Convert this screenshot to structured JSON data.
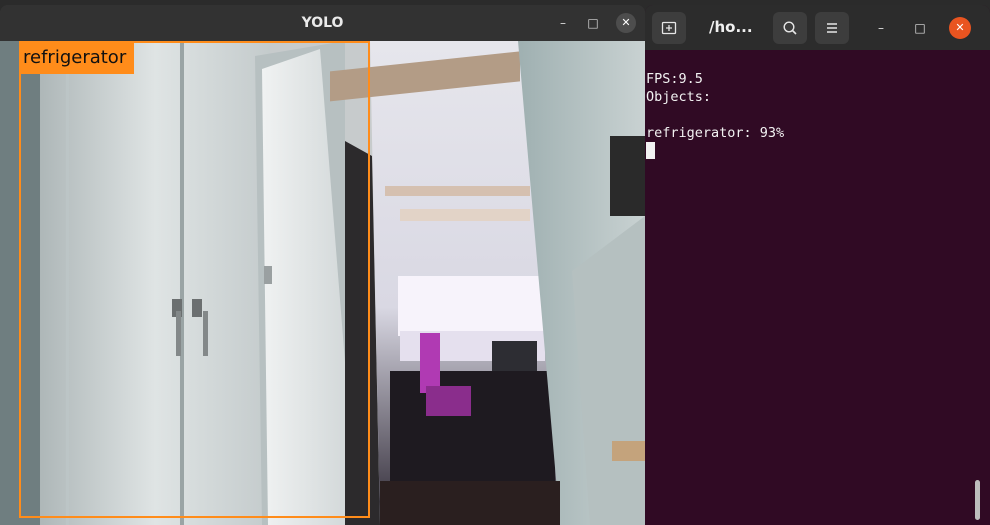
{
  "yolo_window": {
    "title": "YOLO",
    "controls": {
      "minimize": "–",
      "maximize": "□",
      "close": "✕"
    },
    "detection": {
      "label": "refrigerator",
      "color": "#ff8c1a"
    }
  },
  "terminal": {
    "title": "/ho...",
    "controls": {
      "minimize": "–",
      "maximize": "□",
      "close": "✕"
    },
    "lines": {
      "fps": "FPS:9.5",
      "objects": "Objects:",
      "detection": "refrigerator: 93%"
    },
    "colors": {
      "background": "#300a24",
      "close_button": "#e95420"
    }
  }
}
